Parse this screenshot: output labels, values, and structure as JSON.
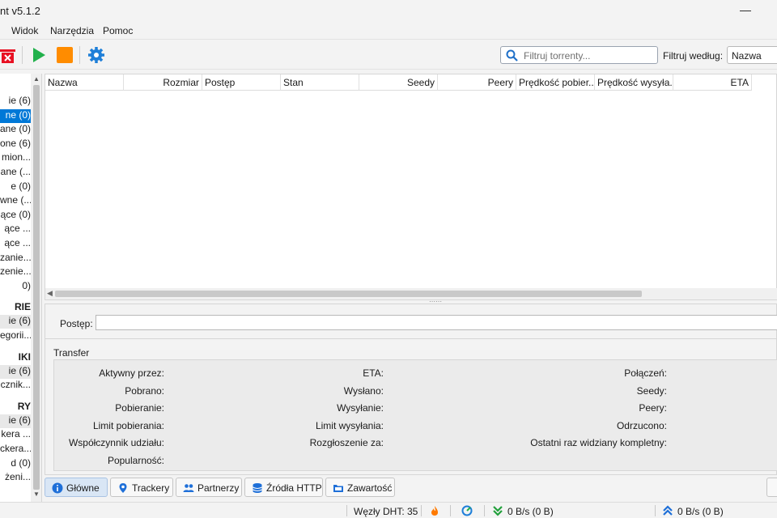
{
  "window": {
    "title": "nt v5.1.2",
    "minimize_glyph": "—"
  },
  "menu": [
    "Widok",
    "Narzędzia",
    "Pomoc"
  ],
  "toolbar": {
    "icons": [
      "delete-icon",
      "resume-icon",
      "pause-icon",
      "settings-icon"
    ],
    "search_placeholder": "Filtruj torrenty...",
    "filter_label": "Filtruj według:",
    "filter_value": "Nazwa"
  },
  "sidebar": {
    "status_items": [
      "ie (6)",
      "ne (0)",
      "ane (0)",
      "one (6)",
      "mion...",
      "ane (...",
      "e (0)",
      "wne (...",
      "ące (0)",
      "ące ...",
      "ące ...",
      "zanie...",
      "zenie...",
      "0)"
    ],
    "categories_title": "RIE",
    "categories_items": [
      "ie (6)",
      "egorii..."
    ],
    "tags_title": "IKI",
    "tags_items": [
      "ie (6)",
      "cznik..."
    ],
    "trackers_title": "RY",
    "trackers_items": [
      "ie (6)",
      "kera ...",
      "ckera...",
      "d (0)",
      "żeni..."
    ]
  },
  "torrent_list": {
    "columns": [
      {
        "label": "Nazwa",
        "align": "left"
      },
      {
        "label": "Rozmiar",
        "align": "right"
      },
      {
        "label": "Postęp",
        "align": "left"
      },
      {
        "label": "Stan",
        "align": "left"
      },
      {
        "label": "Seedy",
        "align": "right"
      },
      {
        "label": "Peery",
        "align": "right"
      },
      {
        "label": "Prędkość pobier...",
        "align": "left"
      },
      {
        "label": "Prędkość wysyła...",
        "align": "left"
      },
      {
        "label": "ETA",
        "align": "right"
      }
    ]
  },
  "details": {
    "progress_label": "Postęp:",
    "transfer_title": "Transfer",
    "col1": [
      "Aktywny przez:",
      "Pobrano:",
      "Pobieranie:",
      "Limit pobierania:",
      "Współczynnik udziału:",
      "Popularność:"
    ],
    "col2": [
      "ETA:",
      "Wysłano:",
      "Wysyłanie:",
      "Limit wysyłania:",
      "Rozgłoszenie za:"
    ],
    "col3": [
      "Połączeń:",
      "Seedy:",
      "Peery:",
      "Odrzucono:",
      "Ostatni raz widziany kompletny:"
    ]
  },
  "tabs": [
    {
      "label": "Główne",
      "icon": "info-icon",
      "active": true
    },
    {
      "label": "Trackery",
      "icon": "pin-icon",
      "active": false
    },
    {
      "label": "Partnerzy",
      "icon": "peers-icon",
      "active": false
    },
    {
      "label": "Źródła HTTP",
      "icon": "database-icon",
      "active": false
    },
    {
      "label": "Zawartość",
      "icon": "folder-icon",
      "active": false
    }
  ],
  "status": {
    "dht": "Węzły DHT: 35",
    "download": "0 B/s (0 B)",
    "upload": "0 B/s (0 B)"
  },
  "colors": {
    "accent": "#0078d7",
    "resume": "#22b14c",
    "pause": "#ff8c00",
    "delete": "#e81123",
    "settings": "#1e7fd8"
  }
}
